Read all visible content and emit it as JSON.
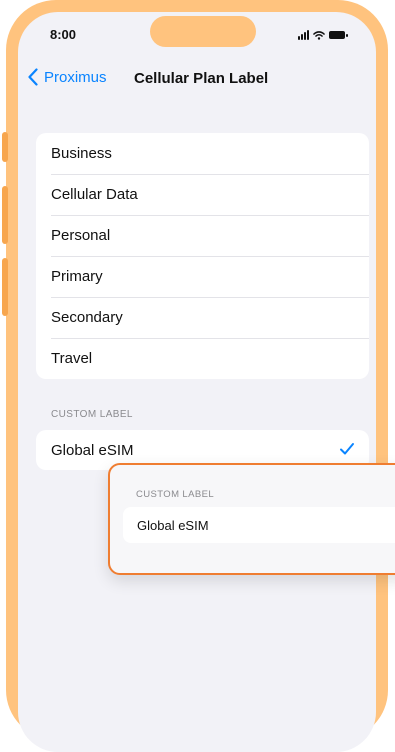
{
  "status_bar": {
    "time": "8:00",
    "icons": [
      "signal-icon",
      "wifi-icon",
      "battery-icon"
    ]
  },
  "nav": {
    "back_label": "Proximus",
    "title": "Cellular Plan Label"
  },
  "plan_labels": [
    {
      "label": "Business"
    },
    {
      "label": "Cellular Data"
    },
    {
      "label": "Personal"
    },
    {
      "label": "Primary"
    },
    {
      "label": "Secondary"
    },
    {
      "label": "Travel"
    }
  ],
  "custom_section": {
    "header": "CUSTOM LABEL",
    "value": "Global eSIM",
    "selected": true
  },
  "callout": {
    "header": "CUSTOM LABEL",
    "value": "Global eSIM"
  },
  "colors": {
    "accent": "#0a84ff",
    "frame": "#ffc37e",
    "callout_border": "#ef7d31",
    "background": "#f2f2f7"
  }
}
